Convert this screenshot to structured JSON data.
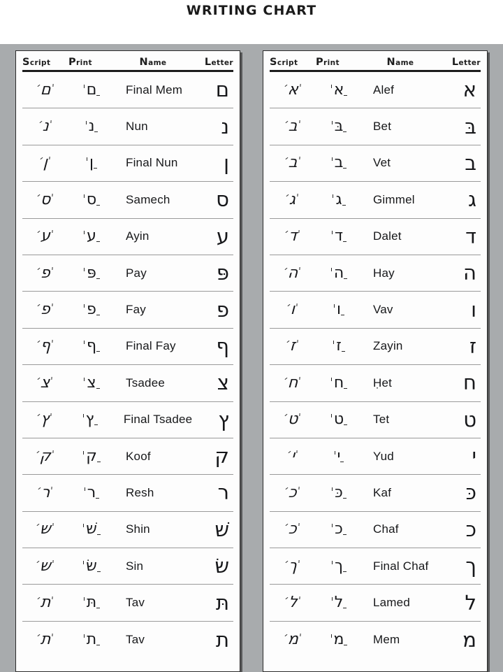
{
  "title": "WRITING CHART",
  "colors": {
    "background": "#ffffff",
    "band": "#a8abad",
    "panel": "#fdfdfd",
    "ink": "#16171a",
    "rule": "#9a9a9a",
    "header_rule": "#1d1d1d"
  },
  "columns": {
    "script": "Script",
    "print": "Print",
    "name": "Name",
    "letter": "Letter"
  },
  "panels": [
    {
      "id": "left-panel",
      "rows": [
        {
          "name": "Final Mem",
          "letter": "ם",
          "script": "ם",
          "print": "ם"
        },
        {
          "name": "Nun",
          "letter": "נ",
          "script": "נ",
          "print": "נ"
        },
        {
          "name": "Final Nun",
          "letter": "ן",
          "script": "ן",
          "print": "ן"
        },
        {
          "name": "Samech",
          "letter": "ס",
          "script": "ס",
          "print": "ס"
        },
        {
          "name": "Ayin",
          "letter": "ע",
          "script": "ע",
          "print": "ע"
        },
        {
          "name": "Pay",
          "letter": "פּ",
          "script": "פ",
          "print": "פּ"
        },
        {
          "name": "Fay",
          "letter": "פ",
          "script": "פ",
          "print": "פ"
        },
        {
          "name": "Final Fay",
          "letter": "ף",
          "script": "ף",
          "print": "ף"
        },
        {
          "name": "Tsadee",
          "letter": "צ",
          "script": "צ",
          "print": "צ"
        },
        {
          "name": "Final Tsadee",
          "letter": "ץ",
          "script": "ץ",
          "print": "ץ"
        },
        {
          "name": "Koof",
          "letter": "ק",
          "script": "ק",
          "print": "ק"
        },
        {
          "name": "Resh",
          "letter": "ר",
          "script": "ר",
          "print": "ר"
        },
        {
          "name": "Shin",
          "letter": "שׁ",
          "script": "ש",
          "print": "שׁ"
        },
        {
          "name": "Sin",
          "letter": "שׂ",
          "script": "ש",
          "print": "שׂ"
        },
        {
          "name": "Tav",
          "letter": "תּ",
          "script": "ת",
          "print": "תּ"
        },
        {
          "name": "Tav",
          "letter": "ת",
          "script": "ת",
          "print": "ת"
        }
      ]
    },
    {
      "id": "right-panel",
      "rows": [
        {
          "name": "Alef",
          "letter": "א",
          "script": "א",
          "print": "א"
        },
        {
          "name": "Bet",
          "letter": "בּ",
          "script": "ב",
          "print": "בּ"
        },
        {
          "name": "Vet",
          "letter": "ב",
          "script": "ב",
          "print": "ב"
        },
        {
          "name": "Gimmel",
          "letter": "ג",
          "script": "ג",
          "print": "ג"
        },
        {
          "name": "Dalet",
          "letter": "ד",
          "script": "ד",
          "print": "ד"
        },
        {
          "name": "Hay",
          "letter": "ה",
          "script": "ה",
          "print": "ה"
        },
        {
          "name": "Vav",
          "letter": "ו",
          "script": "ו",
          "print": "ו"
        },
        {
          "name": "Zayin",
          "letter": "ז",
          "script": "ז",
          "print": "ז"
        },
        {
          "name": "Ḥet",
          "letter": "ח",
          "script": "ח",
          "print": "ח"
        },
        {
          "name": "Tet",
          "letter": "ט",
          "script": "ט",
          "print": "ט"
        },
        {
          "name": "Yud",
          "letter": "י",
          "script": "י",
          "print": "י"
        },
        {
          "name": "Kaf",
          "letter": "כּ",
          "script": "כ",
          "print": "כּ"
        },
        {
          "name": "Chaf",
          "letter": "כ",
          "script": "כ",
          "print": "כ"
        },
        {
          "name": "Final Chaf",
          "letter": "ך",
          "script": "ך",
          "print": "ך"
        },
        {
          "name": "Lamed",
          "letter": "ל",
          "script": "ל",
          "print": "ל"
        },
        {
          "name": "Mem",
          "letter": "מ",
          "script": "מ",
          "print": "מ"
        }
      ]
    }
  ]
}
